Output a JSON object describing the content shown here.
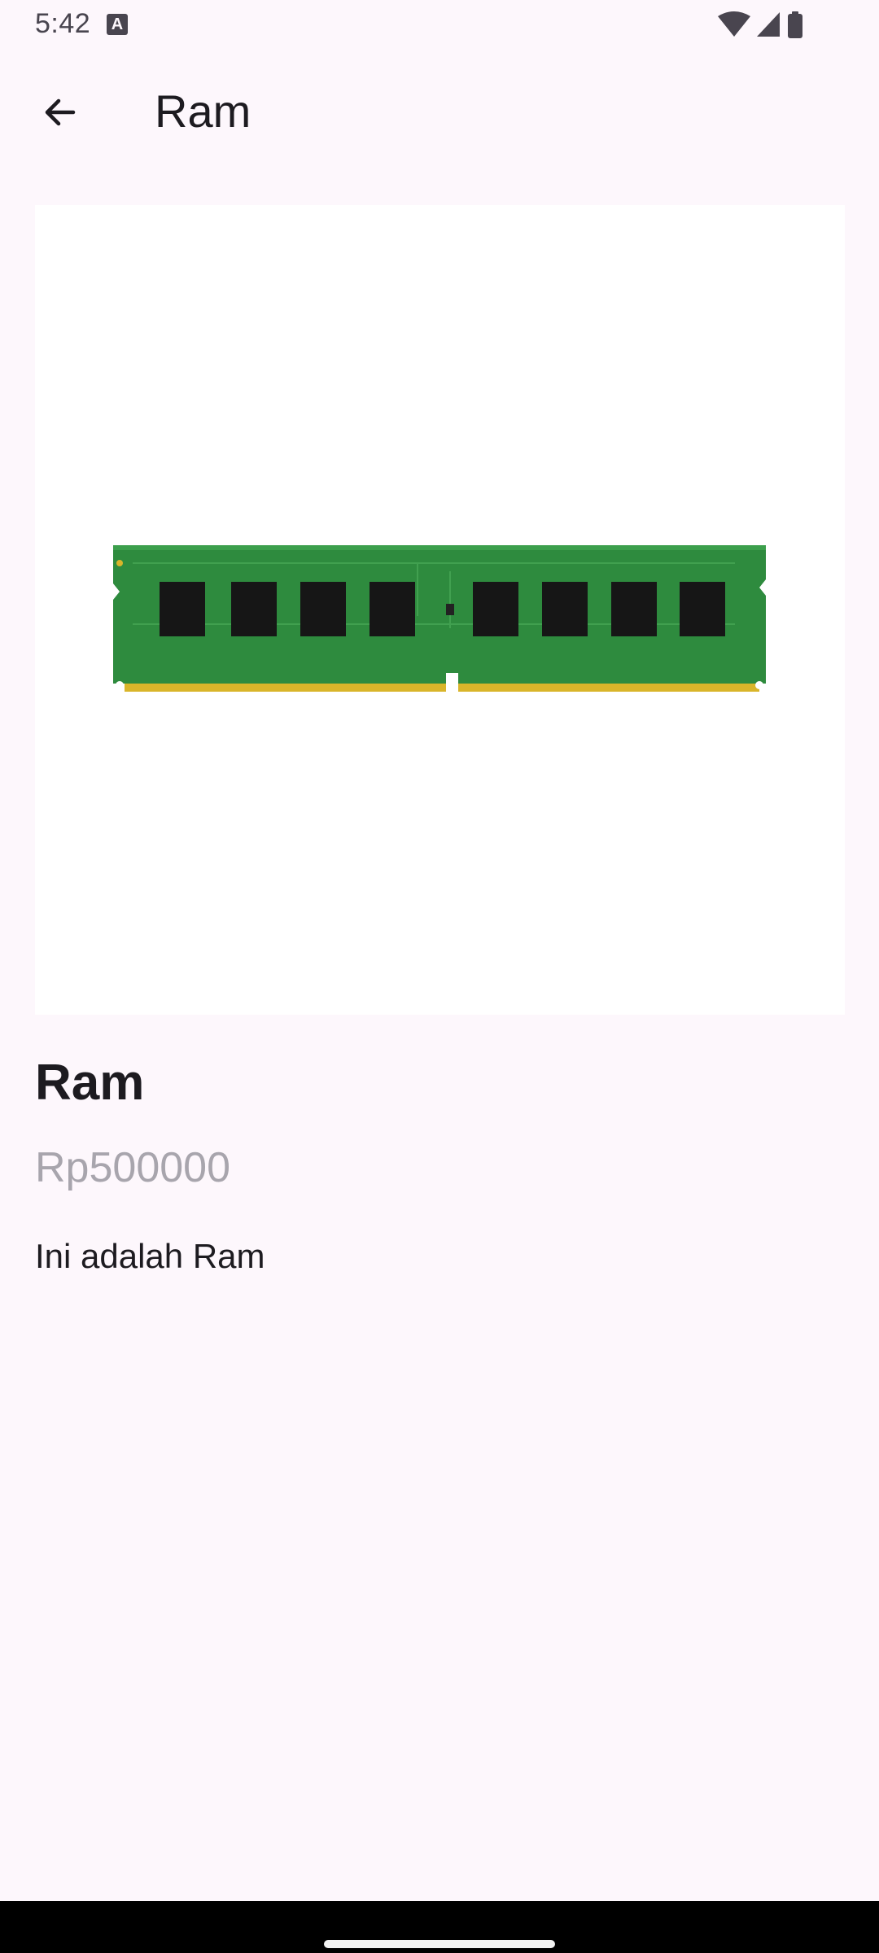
{
  "status_bar": {
    "time": "5:42",
    "notification_icon": "a-letter-icon",
    "notification_glyph": "A",
    "icons": [
      "wifi-icon",
      "cell-signal-icon",
      "battery-icon"
    ]
  },
  "app_bar": {
    "back_icon": "arrow-back-icon",
    "title": "Ram"
  },
  "product": {
    "image": "ram-module-image",
    "name": "Ram",
    "price": "Rp500000",
    "description": "Ini adalah Ram"
  },
  "colors": {
    "background": "#FDF7FC",
    "text_primary": "#1D1B20",
    "text_secondary": "#A8A5AD",
    "pcb_green": "#2E8B3E",
    "gold_contacts": "#D9B52A"
  }
}
